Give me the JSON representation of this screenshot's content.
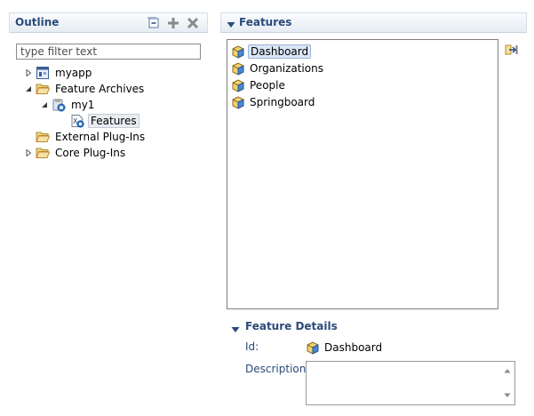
{
  "outline": {
    "title": "Outline",
    "filter_placeholder": "type filter text",
    "toolbar": [
      "collapse-all-icon",
      "add-icon",
      "remove-icon"
    ],
    "tree": [
      {
        "label": "myapp",
        "icon": "application-icon",
        "expanded": false
      },
      {
        "label": "Feature Archives",
        "icon": "folder-open-icon",
        "expanded": true
      },
      {
        "label": "my1",
        "icon": "archive-icon",
        "expanded": true
      },
      {
        "label": "Features",
        "icon": "features-file-icon",
        "selected": true
      },
      {
        "label": "External Plug-Ins",
        "icon": "folder-open-icon",
        "expanded": false
      },
      {
        "label": "Core Plug-Ins",
        "icon": "folder-open-icon",
        "expanded": false
      }
    ]
  },
  "features": {
    "title": "Features",
    "items": [
      {
        "label": "Dashboard",
        "selected": true
      },
      {
        "label": "Organizations"
      },
      {
        "label": "People"
      },
      {
        "label": "Springboard"
      }
    ],
    "side_action": "import-feature-icon"
  },
  "details": {
    "title": "Feature Details",
    "id_label": "Id:",
    "id_value": "Dashboard",
    "description_label": "Description:",
    "description_value": ""
  },
  "colors": {
    "header_title": "#2a4a7a",
    "selection_bg": "#dbe6f6"
  }
}
